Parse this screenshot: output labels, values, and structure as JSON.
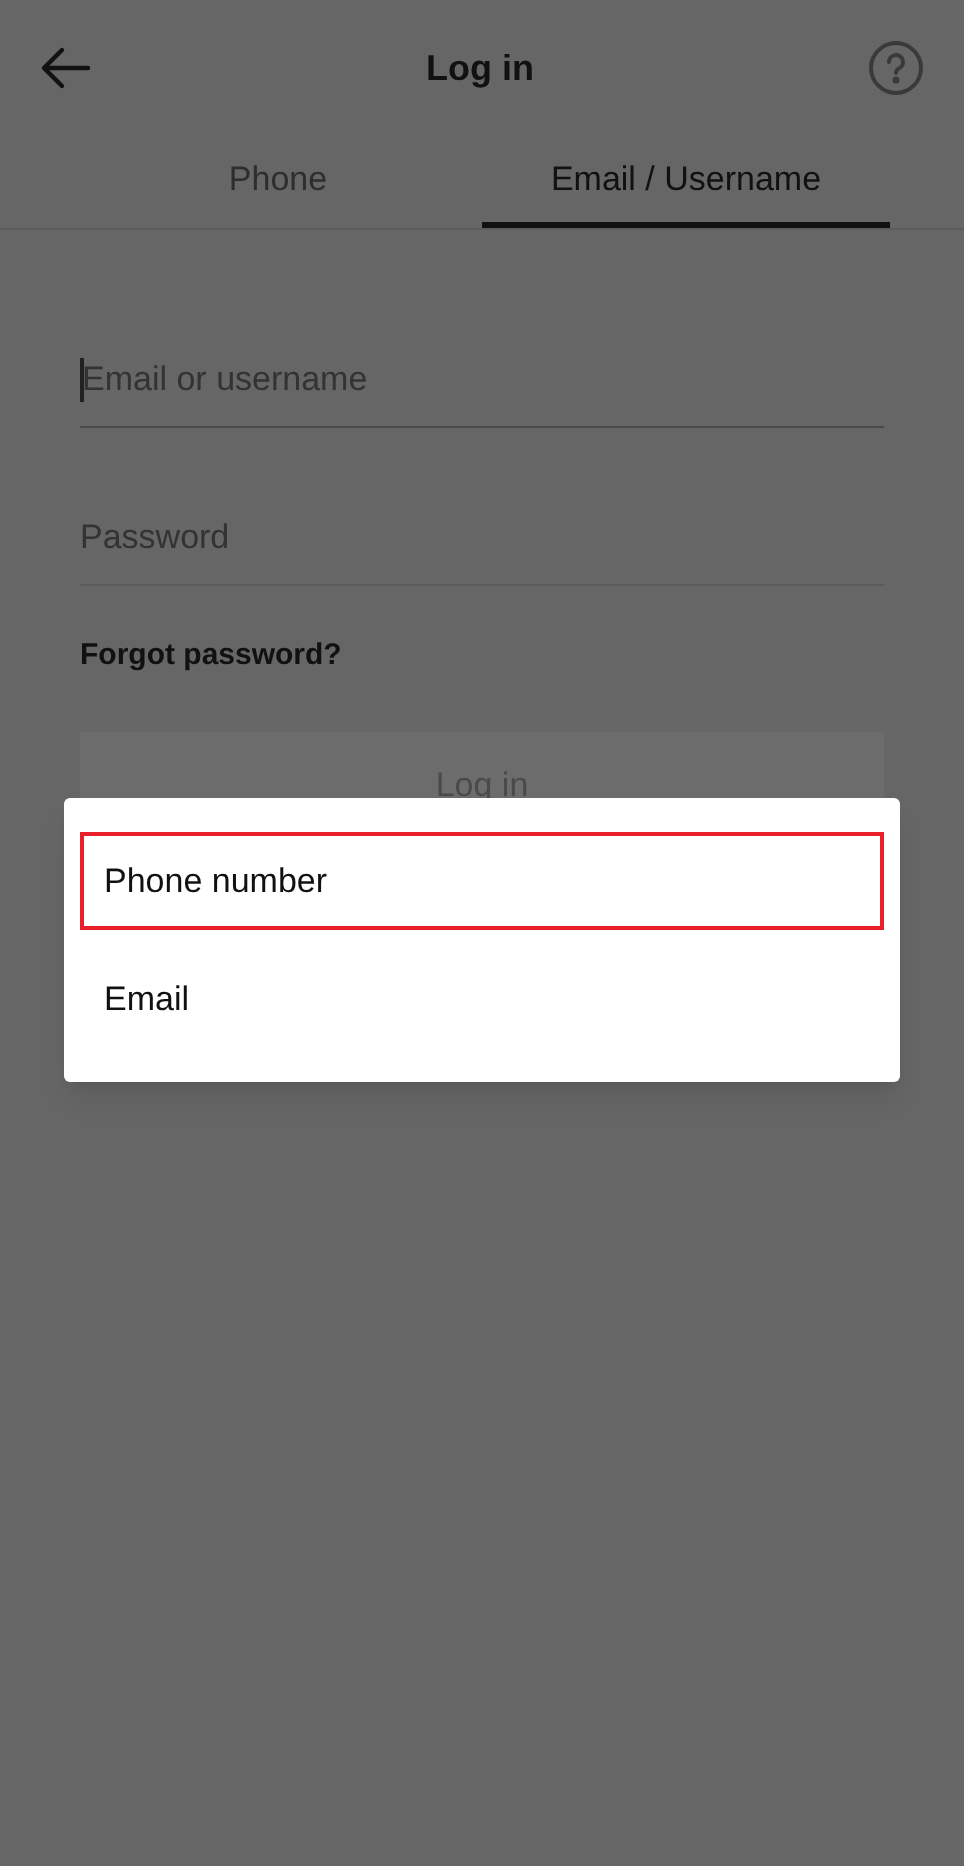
{
  "header": {
    "title": "Log in"
  },
  "tabs": [
    {
      "label": "Phone",
      "selected": false
    },
    {
      "label": "Email / Username",
      "selected": true
    }
  ],
  "fields": [
    {
      "placeholder": "Email or username",
      "focused": true
    },
    {
      "placeholder": "Password",
      "focused": false
    }
  ],
  "forgot_link": "Forgot password?",
  "login_button": "Log in",
  "menu": {
    "items": [
      {
        "label": "Phone number",
        "highlighted": true
      },
      {
        "label": "Email",
        "highlighted": false
      }
    ]
  }
}
